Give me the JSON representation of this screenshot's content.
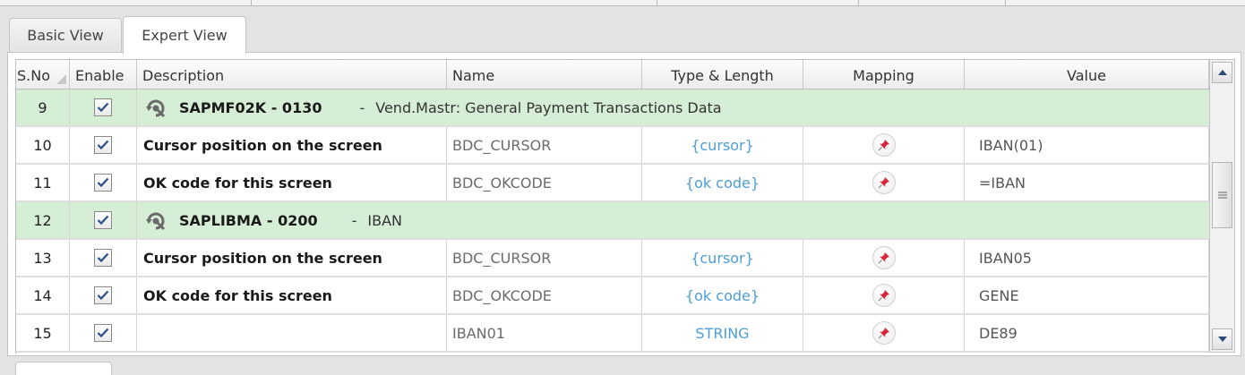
{
  "tabs": {
    "basic": "Basic View",
    "expert": "Expert View"
  },
  "grid": {
    "columns": {
      "sno": "S.No",
      "enable": "Enable",
      "description": "Description",
      "name": "Name",
      "type": "Type & Length",
      "mapping": "Mapping",
      "value": "Value"
    },
    "group1": {
      "sno": "9",
      "screen": "SAPMF02K - 0130",
      "dash": "-",
      "desc": "Vend.Mastr: General Payment Transactions Data"
    },
    "row10": {
      "sno": "10",
      "description": "Cursor position on the screen",
      "name": "BDC_CURSOR",
      "type": "{cursor}",
      "value": "IBAN(01)"
    },
    "row11": {
      "sno": "11",
      "description": "OK code for this screen",
      "name": "BDC_OKCODE",
      "type": "{ok code}",
      "value": "=IBAN"
    },
    "group2": {
      "sno": "12",
      "screen": "SAPLIBMA - 0200",
      "dash": "-",
      "desc": "IBAN"
    },
    "row13": {
      "sno": "13",
      "description": "Cursor position on the screen",
      "name": "BDC_CURSOR",
      "type": "{cursor}",
      "value": "IBAN05"
    },
    "row14": {
      "sno": "14",
      "description": "OK code for this screen",
      "name": "BDC_OKCODE",
      "type": "{ok code}",
      "value": "GENE"
    },
    "row15": {
      "sno": "15",
      "description": "",
      "name": "IBAN01",
      "type": "STRING",
      "value": "DE89"
    }
  },
  "icons": {
    "checkbox": "checkbox-checked-icon",
    "group": "screen-refresh-icon",
    "mapping": "pin-icon",
    "scroll_up": "arrow-up-icon",
    "scroll_down": "arrow-down-icon",
    "thumb_grip": "grip-lines-icon"
  },
  "colors": {
    "group_row": "#d6eed6",
    "type_text": "#4d9dd6",
    "pin_red": "#d9263a",
    "check_blue": "#2a4f8a"
  }
}
